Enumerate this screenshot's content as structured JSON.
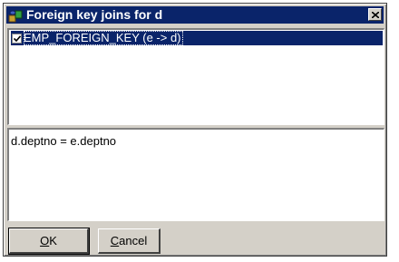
{
  "window": {
    "title": "Foreign key joins for d",
    "icon": "database-icon"
  },
  "joins_list": {
    "items": [
      {
        "label": "EMP_FOREIGN_KEY (e -> d)",
        "checked": true,
        "selected": true
      }
    ]
  },
  "condition": {
    "text": "d.deptno = e.deptno"
  },
  "buttons": {
    "ok_mnemonic": "O",
    "ok_rest": "K",
    "cancel_mnemonic": "C",
    "cancel_rest": "ancel"
  },
  "colors": {
    "titlebar": "#0a246a",
    "face": "#d4d0c8",
    "selection": "#0a246a"
  }
}
